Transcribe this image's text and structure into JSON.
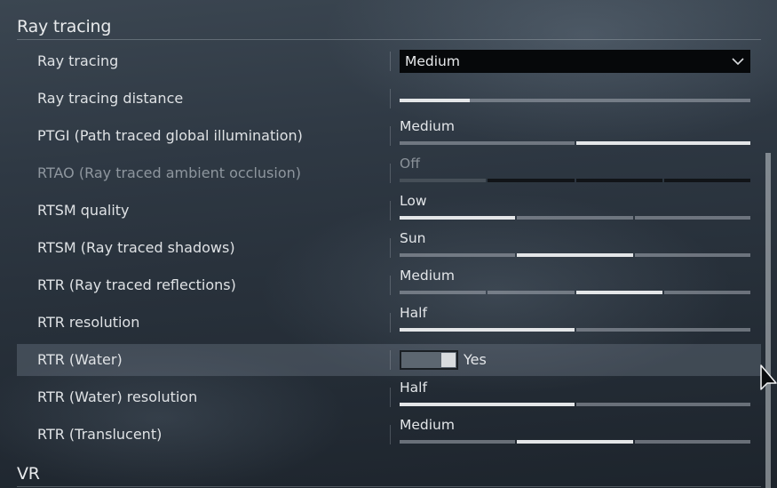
{
  "sections": {
    "ray_tracing": "Ray tracing",
    "vr": "VR"
  },
  "settings": {
    "ray_tracing": {
      "label": "Ray tracing",
      "value": "Medium"
    },
    "ray_tracing_distance": {
      "label": "Ray tracing distance",
      "level": 0.2
    },
    "ptgi": {
      "label": "PTGI (Path traced global illumination)",
      "value": "Medium",
      "segments": 2,
      "selected_index": 1
    },
    "rtao": {
      "label": "RTAO (Ray traced ambient occlusion)",
      "value": "Off",
      "segments": 4,
      "selected_index": 0,
      "disabled": true
    },
    "rtsm_quality": {
      "label": "RTSM quality",
      "value": "Low",
      "segments": 3,
      "selected_index": 0
    },
    "rtsm_shadows": {
      "label": "RTSM (Ray traced shadows)",
      "value": "Sun",
      "segments": 3,
      "selected_index": 1
    },
    "rtr": {
      "label": "RTR (Ray traced reflections)",
      "value": "Medium",
      "segments": 4,
      "selected_index": 2
    },
    "rtr_resolution": {
      "label": "RTR resolution",
      "value": "Half",
      "segments": 2,
      "selected_index": 0
    },
    "rtr_water": {
      "label": "RTR (Water)",
      "value": "Yes",
      "checked": true
    },
    "rtr_water_resolution": {
      "label": "RTR (Water) resolution",
      "value": "Half",
      "segments": 2,
      "selected_index": 0
    },
    "rtr_translucent": {
      "label": "RTR (Translucent)",
      "value": "Medium",
      "segments": 3,
      "selected_index": 1
    }
  },
  "icons": {
    "dropdown": "chevron-down-icon",
    "cursor": "mouse-pointer-icon"
  }
}
